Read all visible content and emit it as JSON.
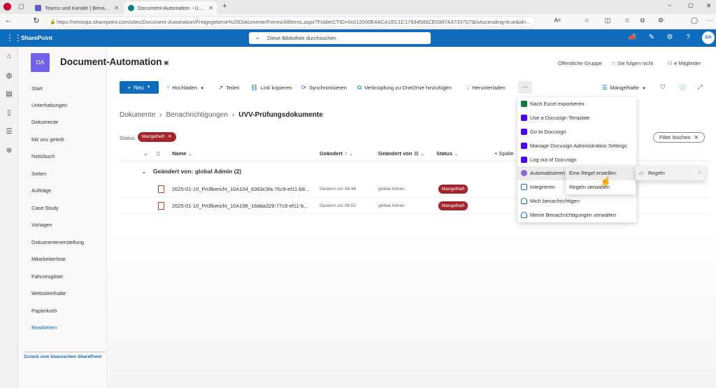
{
  "browser": {
    "tabs": [
      {
        "label": "Teams und Kanäle | Benachrichtigung"
      },
      {
        "label": "Document-Automation - UVV-Prüfungsdokumente"
      }
    ],
    "url": "https://verooqa.sharepoint.com/sites/Document-Automation/Freigegebene%20Dokumente/Forms/AllItems.aspx?FolderCTID=0x012000E4ACA1EC1C17934585CE0387A37337D7&isAscending=true&id=..."
  },
  "suitebar": {
    "brand": "SharePoint",
    "search_placeholder": "Diese Bibliothek durchsuchen",
    "avatar": "GA"
  },
  "site": {
    "logo": "DA",
    "title": "Document-Automation",
    "group": "Öffentliche Gruppe",
    "follow": "Sie folgen nicht",
    "members": "4 Mitglieder"
  },
  "leftnav": {
    "items": [
      "Start",
      "Unterhaltungen",
      "Dokumente",
      "Mit uns geteilt",
      "Notizbuch",
      "Seiten",
      "Aufträge",
      "Case Study",
      "Vorlagen",
      "Dokumentenerstellung",
      "Mitarbeiterliste",
      "Fahrzeugliste",
      "Websiteinhalte",
      "Papierkorb"
    ],
    "edit": "Bearbeiten",
    "classic": "Zurück zum klassischen SharePoint"
  },
  "commands": {
    "new": "Neu",
    "upload": "Hochladen",
    "share": "Teilen",
    "copy_link": "Link kopieren",
    "sync": "Synchronisieren",
    "shortcut": "Verknüpfung zu OneDrive hinzufügen",
    "download": "Herunterladen",
    "more": "···",
    "view": "Mangelhafte"
  },
  "breadcrumb": [
    "Dokumente",
    "Benachrichtigungen",
    "UVV-Prüfungsdokumente"
  ],
  "filter": {
    "label": "Status:",
    "chip": "Mangelhaft",
    "clear": "Filter löschen"
  },
  "columns": {
    "name": "Name",
    "modified": "Geändert",
    "modified_by": "Geändert von",
    "status": "Status",
    "add": "+ Spalte"
  },
  "group": "Geändert von: global Admin (2)",
  "files": [
    {
      "name": "2025-01-10_Prüfbericht_10A104_8363c3fa-76c9-ef11-b8...",
      "modified": "Gestern um 08:46",
      "by": "global Admin",
      "status": "Mangelhaft"
    },
    {
      "name": "2025-01-10_Prüfbericht_10A198_16dda329-77c9-ef11-b...",
      "modified": "Gestern um 08:52",
      "by": "global Admin",
      "status": "Mangelhaft"
    }
  ],
  "menu": {
    "items": [
      "Nach Excel exportieren",
      "Use a Docusign Template",
      "Go to Docusign",
      "Manage Docusign Administration Settings",
      "Log out of Docusign",
      "Automatisieren",
      "Integrieren",
      "Mich benachrichtigen",
      "Meine Benachrichtigungen verwalten"
    ]
  },
  "submenu": {
    "items": [
      "Eine Regel erstellen",
      "Regeln verwalten"
    ],
    "right": "Regeln"
  }
}
